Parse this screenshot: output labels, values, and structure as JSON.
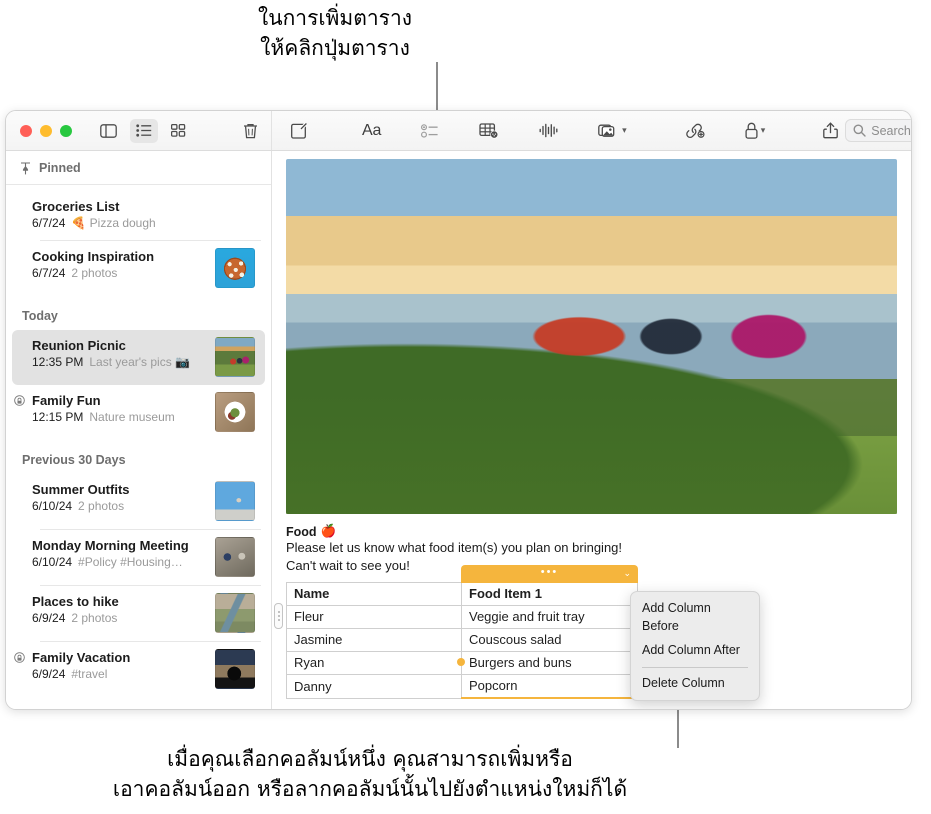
{
  "callouts": {
    "top": "ในการเพิ่มตาราง\nให้คลิกปุ่มตาราง",
    "bottom": "เมื่อคุณเลือกคอลัมน์หนึ่ง คุณสามารถเพิ่มหรือ\nเอาคอลัมน์ออก หรือลากคอลัมน์นั้นไปยังตำแหน่งใหม่ก็ได้"
  },
  "colors": {
    "accent_orange": "#f5b53d",
    "traffic_red": "#ff5f57",
    "traffic_yellow": "#febc2e",
    "traffic_green": "#28c840",
    "selected_row": "#e2e2e2"
  },
  "toolbar": {
    "left_icons": [
      {
        "name": "sidebar-toggle-icon",
        "label": "Sidebar"
      },
      {
        "name": "list-view-icon",
        "label": "List View"
      },
      {
        "name": "gallery-view-icon",
        "label": "Gallery View"
      },
      {
        "name": "delete-note-icon",
        "label": "Delete"
      }
    ],
    "right_icons": [
      {
        "name": "compose-note-icon",
        "label": "New Note"
      },
      {
        "name": "format-icon",
        "label": "Aa"
      },
      {
        "name": "checklist-icon",
        "label": "Checklist"
      },
      {
        "name": "table-icon",
        "label": "Table"
      },
      {
        "name": "audio-icon",
        "label": "Record Audio"
      },
      {
        "name": "media-icon",
        "label": "Media"
      },
      {
        "name": "link-icon",
        "label": "Add Link"
      },
      {
        "name": "lock-icon",
        "label": "Lock Note"
      },
      {
        "name": "share-icon",
        "label": "Share"
      }
    ],
    "format_label": "Aa"
  },
  "search": {
    "placeholder": "Search",
    "value": ""
  },
  "sidebar": {
    "pinned_label": "Pinned",
    "sections": [
      {
        "label": "",
        "notes": [
          {
            "title": "Groceries List",
            "date": "6/7/24",
            "subtitle": "🍕 Pizza dough",
            "thumb": "",
            "locked": false
          },
          {
            "title": "Cooking Inspiration",
            "date": "6/7/24",
            "subtitle": "2 photos",
            "thumb": "th-pizza",
            "locked": false
          }
        ]
      },
      {
        "label": "Today",
        "notes": [
          {
            "title": "Reunion Picnic",
            "date": "12:35 PM",
            "subtitle": "Last year's pics 📷",
            "thumb": "th-picnic",
            "locked": false,
            "selected": true
          },
          {
            "title": "Family Fun",
            "date": "12:15 PM",
            "subtitle": "Nature museum",
            "thumb": "th-salad",
            "locked": true
          }
        ]
      },
      {
        "label": "Previous 30 Days",
        "notes": [
          {
            "title": "Summer Outfits",
            "date": "6/10/24",
            "subtitle": "2 photos",
            "thumb": "th-skate-blue",
            "locked": false
          },
          {
            "title": "Monday Morning Meeting",
            "date": "6/10/24",
            "subtitle": "#Policy #Housing…",
            "thumb": "th-climb",
            "locked": false
          },
          {
            "title": "Places to hike",
            "date": "6/9/24",
            "subtitle": "2 photos",
            "thumb": "th-river",
            "locked": false
          },
          {
            "title": "Family Vacation",
            "date": "6/9/24",
            "subtitle": "#travel",
            "thumb": "th-silhouette",
            "locked": true
          }
        ]
      }
    ]
  },
  "note": {
    "photo_alt": "Three people sitting on a blanket on a grassy cliff at sunset",
    "heading": "Food",
    "heading_emoji": "🍎",
    "paragraph_1": "Please let us know what food item(s) you plan on bringing!",
    "paragraph_2": "Can't wait to see you!",
    "table": {
      "headers": [
        "Name",
        "Food Item 1"
      ],
      "rows": [
        [
          "Fleur",
          "Veggie and fruit tray"
        ],
        [
          "Jasmine",
          "Couscous salad"
        ],
        [
          "Ryan",
          "Burgers and buns"
        ],
        [
          "Danny",
          "Popcorn"
        ]
      ],
      "selected_column_index": 1
    }
  },
  "context_menu": {
    "items": [
      {
        "label": "Add Column Before"
      },
      {
        "label": "Add Column After"
      },
      {
        "label": "Delete Column"
      }
    ]
  }
}
